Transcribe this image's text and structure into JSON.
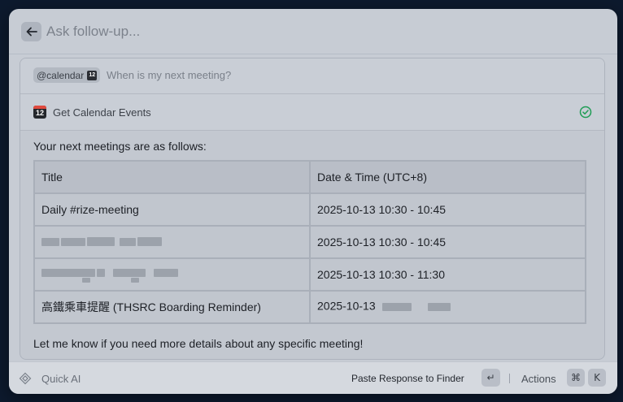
{
  "header": {
    "placeholder": "Ask follow-up..."
  },
  "query": {
    "mention": "@calendar",
    "mention_badge": "12",
    "text": "When is my next meeting?"
  },
  "tool": {
    "icon_number": "12",
    "label": "Get Calendar Events",
    "status_color": "#1f9d55"
  },
  "response": {
    "intro": "Your next meetings are as follows:",
    "table": {
      "headers": [
        "Title",
        "Date & Time (UTC+8)"
      ],
      "rows": [
        {
          "title": "Daily #rize-meeting",
          "datetime": "2025-10-13 10:30 - 10:45"
        },
        {
          "title": "",
          "datetime": "2025-10-13 10:30 - 10:45"
        },
        {
          "title": "",
          "datetime": "2025-10-13 10:30 - 11:30"
        },
        {
          "title": "高鐵乘車提醒 (THSRC Boarding Reminder)",
          "datetime": "2025-10-13"
        }
      ]
    },
    "outro": "Let me know if you need more details about any specific meeting!"
  },
  "footer": {
    "app_name": "Quick AI",
    "paste_label": "Paste Response to Finder",
    "paste_key": "↵",
    "actions_label": "Actions",
    "actions_key_1": "⌘",
    "actions_key_2": "K"
  }
}
